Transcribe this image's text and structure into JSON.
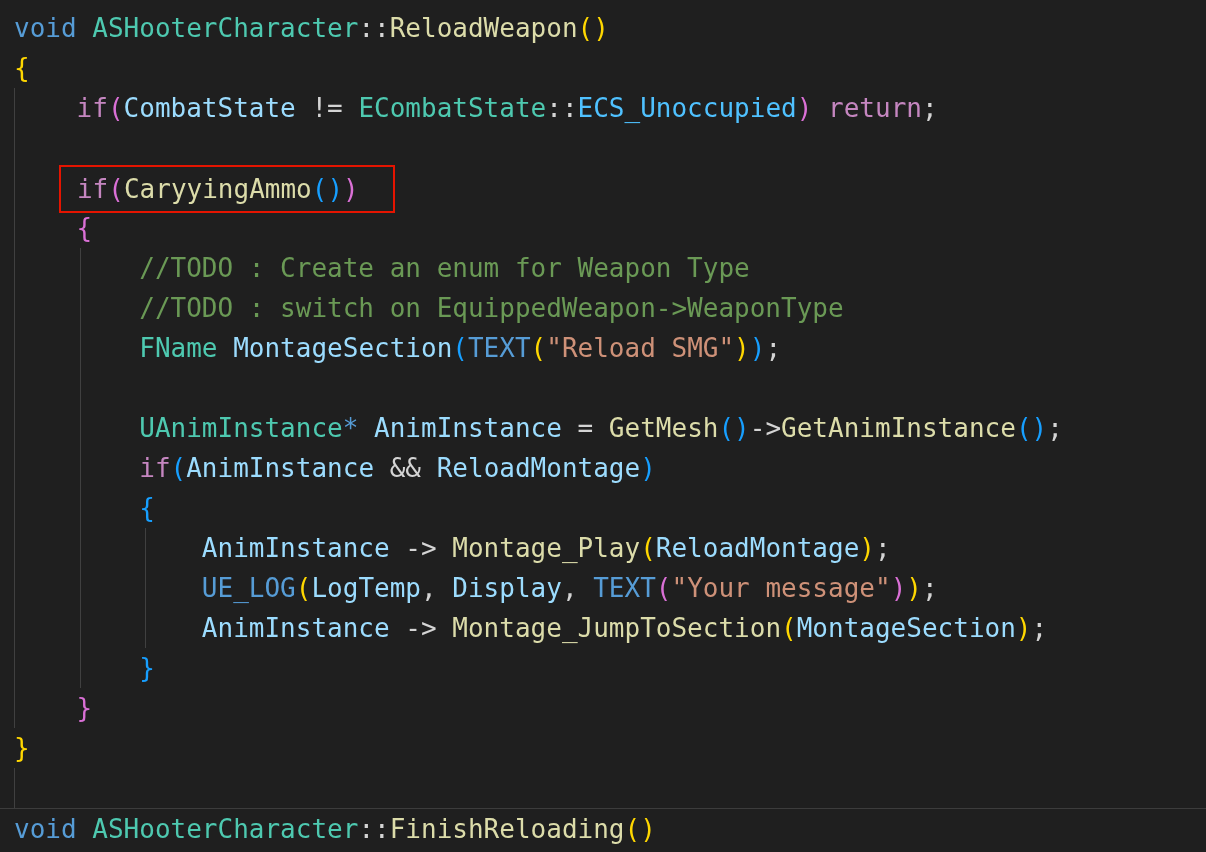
{
  "editor": {
    "lines": [
      {
        "kind": "code",
        "highlighted": false,
        "tokens": [
          {
            "text": "void ",
            "kind": "keyword"
          },
          {
            "text": "ASHooterCharacter",
            "kind": "type"
          },
          {
            "text": "::",
            "kind": "plain"
          },
          {
            "text": "ReloadWeapon",
            "kind": "func"
          },
          {
            "text": "()",
            "kind": "b1"
          }
        ]
      },
      {
        "kind": "code",
        "highlighted": false,
        "tokens": [
          {
            "text": "{",
            "kind": "b1"
          }
        ]
      },
      {
        "kind": "code",
        "highlighted": false,
        "tokens": [
          {
            "text": "    if",
            "kind": "control"
          },
          {
            "text": "(",
            "kind": "b2"
          },
          {
            "text": "CombatState",
            "kind": "var"
          },
          {
            "text": " != ",
            "kind": "plain"
          },
          {
            "text": "ECombatState",
            "kind": "type"
          },
          {
            "text": "::",
            "kind": "plain"
          },
          {
            "text": "ECS_Unoccupied",
            "kind": "enum"
          },
          {
            "text": ")",
            "kind": "b2"
          },
          {
            "text": " return",
            "kind": "control"
          },
          {
            "text": ";",
            "kind": "plain"
          }
        ]
      },
      {
        "kind": "code",
        "highlighted": false
      },
      {
        "kind": "code",
        "highlighted": true,
        "tokens": [
          {
            "text": "    if",
            "kind": "control"
          },
          {
            "text": "(",
            "kind": "b2"
          },
          {
            "text": "CaryyingAmmo",
            "kind": "func"
          },
          {
            "text": "()",
            "kind": "b3"
          },
          {
            "text": ")",
            "kind": "b2"
          }
        ]
      },
      {
        "kind": "code",
        "highlighted": false,
        "tokens": [
          {
            "text": "    {",
            "kind": "b2"
          }
        ]
      },
      {
        "kind": "code",
        "highlighted": false,
        "tokens": [
          {
            "text": "        //TODO : Create an enum for Weapon Type",
            "kind": "comment"
          }
        ]
      },
      {
        "kind": "code",
        "highlighted": false,
        "tokens": [
          {
            "text": "        //TODO : switch on EquippedWeapon->WeaponType",
            "kind": "comment"
          }
        ]
      },
      {
        "kind": "code",
        "highlighted": false,
        "tokens": [
          {
            "text": "        FName ",
            "kind": "type"
          },
          {
            "text": "MontageSection",
            "kind": "var"
          },
          {
            "text": "(",
            "kind": "b3"
          },
          {
            "text": "TEXT",
            "kind": "macro"
          },
          {
            "text": "(",
            "kind": "b1"
          },
          {
            "text": "\"Reload SMG\"",
            "kind": "string"
          },
          {
            "text": ")",
            "kind": "b1"
          },
          {
            "text": ")",
            "kind": "b3"
          },
          {
            "text": ";",
            "kind": "plain"
          }
        ]
      },
      {
        "kind": "code",
        "highlighted": false
      },
      {
        "kind": "code",
        "highlighted": false,
        "tokens": [
          {
            "text": "        UAnimInstance",
            "kind": "type"
          },
          {
            "text": "* ",
            "kind": "keyword"
          },
          {
            "text": "AnimInstance",
            "kind": "var"
          },
          {
            "text": " = ",
            "kind": "plain"
          },
          {
            "text": "GetMesh",
            "kind": "func"
          },
          {
            "text": "()",
            "kind": "b3"
          },
          {
            "text": "->",
            "kind": "plain"
          },
          {
            "text": "GetAnimInstance",
            "kind": "func"
          },
          {
            "text": "()",
            "kind": "b3"
          },
          {
            "text": ";",
            "kind": "plain"
          }
        ]
      },
      {
        "kind": "code",
        "highlighted": false,
        "tokens": [
          {
            "text": "        if",
            "kind": "control"
          },
          {
            "text": "(",
            "kind": "b3"
          },
          {
            "text": "AnimInstance",
            "kind": "var"
          },
          {
            "text": " && ",
            "kind": "plain"
          },
          {
            "text": "ReloadMontage",
            "kind": "var"
          },
          {
            "text": ")",
            "kind": "b3"
          }
        ]
      },
      {
        "kind": "code",
        "highlighted": false,
        "tokens": [
          {
            "text": "        {",
            "kind": "b3"
          }
        ]
      },
      {
        "kind": "code",
        "highlighted": false,
        "tokens": [
          {
            "text": "            AnimInstance",
            "kind": "var"
          },
          {
            "text": " -> ",
            "kind": "plain"
          },
          {
            "text": "Montage_Play",
            "kind": "func"
          },
          {
            "text": "(",
            "kind": "b1"
          },
          {
            "text": "ReloadMontage",
            "kind": "var"
          },
          {
            "text": ")",
            "kind": "b1"
          },
          {
            "text": ";",
            "kind": "plain"
          }
        ]
      },
      {
        "kind": "code",
        "highlighted": false,
        "tokens": [
          {
            "text": "            UE_LOG",
            "kind": "macro"
          },
          {
            "text": "(",
            "kind": "b1"
          },
          {
            "text": "LogTemp",
            "kind": "var"
          },
          {
            "text": ", ",
            "kind": "plain"
          },
          {
            "text": "Display",
            "kind": "var"
          },
          {
            "text": ", ",
            "kind": "plain"
          },
          {
            "text": "TEXT",
            "kind": "macro"
          },
          {
            "text": "(",
            "kind": "b2"
          },
          {
            "text": "\"Your message\"",
            "kind": "string"
          },
          {
            "text": ")",
            "kind": "b2"
          },
          {
            "text": ")",
            "kind": "b1"
          },
          {
            "text": ";",
            "kind": "plain"
          }
        ]
      },
      {
        "kind": "code",
        "highlighted": false,
        "tokens": [
          {
            "text": "            AnimInstance",
            "kind": "var"
          },
          {
            "text": " -> ",
            "kind": "plain"
          },
          {
            "text": "Montage_JumpToSection",
            "kind": "func"
          },
          {
            "text": "(",
            "kind": "b1"
          },
          {
            "text": "MontageSection",
            "kind": "var"
          },
          {
            "text": ")",
            "kind": "b1"
          },
          {
            "text": ";",
            "kind": "plain"
          }
        ]
      },
      {
        "kind": "code",
        "highlighted": false,
        "tokens": [
          {
            "text": "        }",
            "kind": "b3"
          }
        ]
      },
      {
        "kind": "code",
        "highlighted": false,
        "tokens": [
          {
            "text": "    }",
            "kind": "b2"
          }
        ]
      },
      {
        "kind": "code",
        "highlighted": false,
        "tokens": [
          {
            "text": "}",
            "kind": "b1"
          }
        ]
      },
      {
        "kind": "code",
        "highlighted": false
      },
      {
        "kind": "sticky",
        "highlighted": false,
        "tokens": [
          {
            "text": "void ",
            "kind": "keyword"
          },
          {
            "text": "ASHooterCharacter",
            "kind": "type"
          },
          {
            "text": "::",
            "kind": "plain"
          },
          {
            "text": "FinishReloading",
            "kind": "func"
          },
          {
            "text": "()",
            "kind": "b1"
          }
        ]
      }
    ]
  }
}
